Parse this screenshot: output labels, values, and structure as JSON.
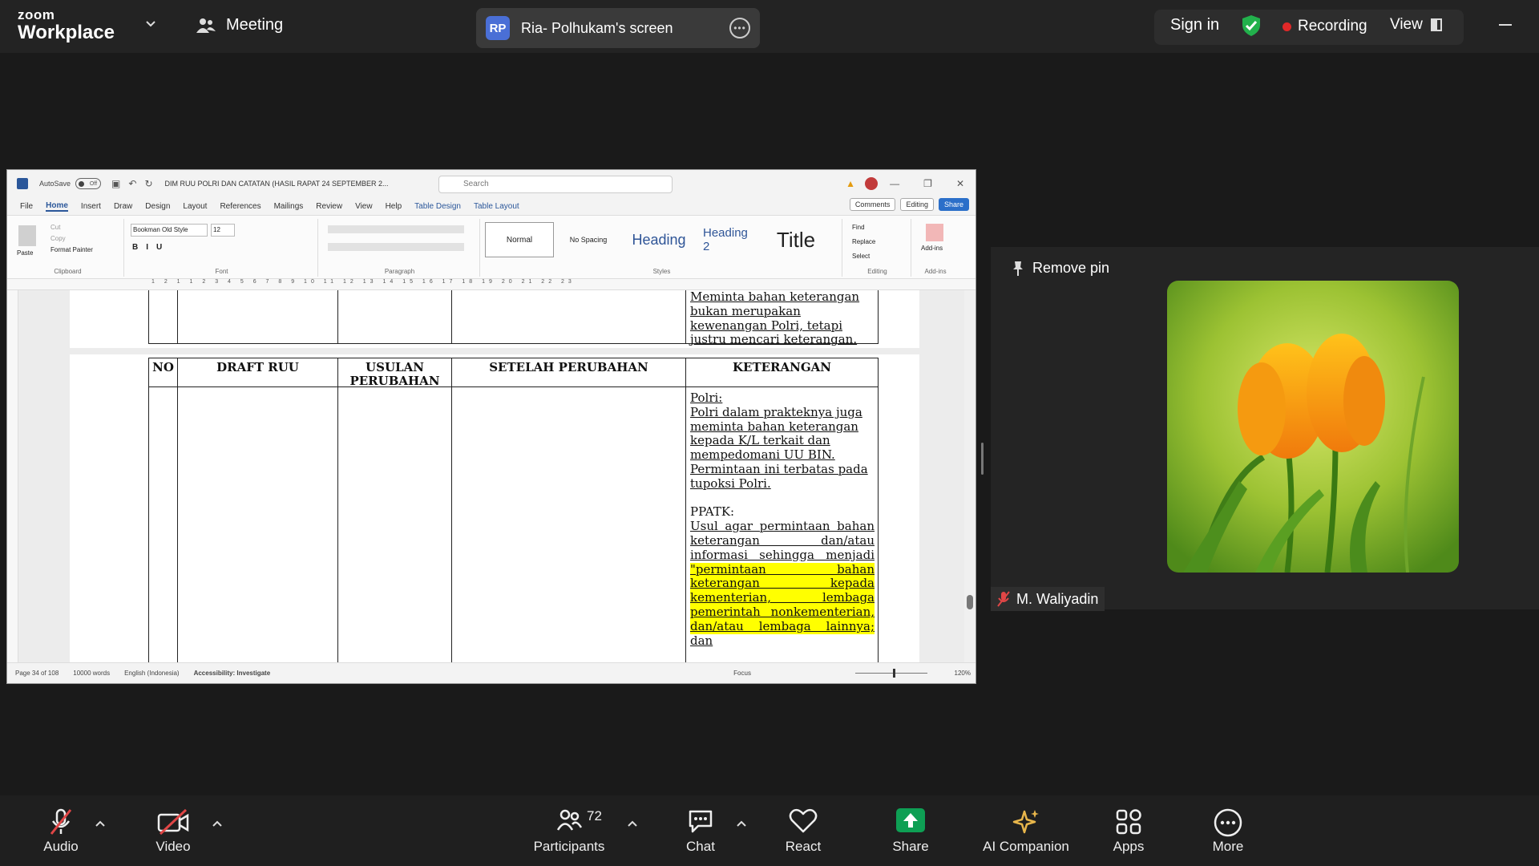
{
  "app": {
    "logo_top": "zoom",
    "logo_bottom": "Workplace",
    "meeting_label": "Meeting",
    "screen_badge": "RP",
    "screen_label": "Ria- Polhukam's screen",
    "sign_in": "Sign in",
    "recording": "Recording",
    "view": "View"
  },
  "word": {
    "autosave": "AutoSave",
    "toggle": "Off",
    "doc_title": "DIM RUU POLRI DAN CATATAN (HASIL RAPAT 24 SEPTEMBER 2...",
    "search_placeholder": "Search",
    "menus": [
      "File",
      "Home",
      "Insert",
      "Draw",
      "Design",
      "Layout",
      "References",
      "Mailings",
      "Review",
      "View",
      "Help",
      "Table Design",
      "Table Layout"
    ],
    "comments": "Comments",
    "editing": "Editing",
    "share": "Share",
    "clipboard": {
      "paste": "Paste",
      "cut": "Cut",
      "copy": "Copy",
      "format_painter": "Format Painter",
      "caption": "Clipboard"
    },
    "font": {
      "name": "Bookman Old Style",
      "size": "12",
      "caption": "Font"
    },
    "paragraph_caption": "Paragraph",
    "styles": {
      "normal": "Normal",
      "no_spacing": "No Spacing",
      "heading1": "Heading",
      "heading2": "Heading 2",
      "title": "Title",
      "caption": "Styles"
    },
    "editing_group": {
      "find": "Find",
      "replace": "Replace",
      "select": "Select",
      "caption": "Editing"
    },
    "addins": {
      "label": "Add-ins",
      "caption": "Add-ins"
    },
    "ruler": "1 2 1 1 2 3 4 5 6 7 8 9 10 11 12 13 14 15 16 17 18 19 20 21 22 23",
    "table": {
      "headers": {
        "no": "NO",
        "draft": "DRAFT RUU",
        "usulan_1": "USULAN",
        "usulan_2": "PERUBAHAN",
        "setelah": "SETELAH PERUBAHAN",
        "keterangan": "KETERANGAN"
      },
      "prev_lines": [
        "Meminta bahan keterangan",
        "bukan merupakan",
        "kewenangan Polri, tetapi",
        "justru mencari keterangan."
      ],
      "polri_label": "Polri:",
      "polri_lines": [
        "Polri dalam prakteknya juga",
        "meminta bahan keterangan",
        "kepada K/L terkait dan",
        "mempedomani UU BIN.",
        "Permintaan ini terbatas pada",
        "tupoksi Polri."
      ],
      "ppatk_label": "PPATK:",
      "ppatk_lines": [
        "Usul agar permintaan bahan",
        "keterangan dan/atau",
        "informasi sehingga menjadi"
      ],
      "ppatk_highlight": [
        "\"permintaan bahan",
        "keterangan kepada",
        "kementerian, lembaga",
        "pemerintah nonkementerian,",
        "dan/atau lembaga lainnya;"
      ],
      "ppatk_last": "dan"
    },
    "status": {
      "page": "Page 34 of 108",
      "words": "10000 words",
      "language": "English (Indonesia)",
      "accessibility": "Accessibility: Investigate",
      "focus": "Focus",
      "zoom": "120%"
    }
  },
  "panel": {
    "remove_pin": "Remove pin",
    "participant_name": "M. Waliyadin"
  },
  "toolbar": {
    "audio": "Audio",
    "video": "Video",
    "participants": "Participants",
    "participant_count": "72",
    "chat": "Chat",
    "react": "React",
    "share": "Share",
    "ai_companion": "AI Companion",
    "apps": "Apps",
    "more": "More"
  },
  "colors": {
    "share_green": "#0e9f54",
    "ai_gold": "#e8b64b",
    "record_red": "#e02828",
    "highlight_yellow": "#ffff00"
  }
}
